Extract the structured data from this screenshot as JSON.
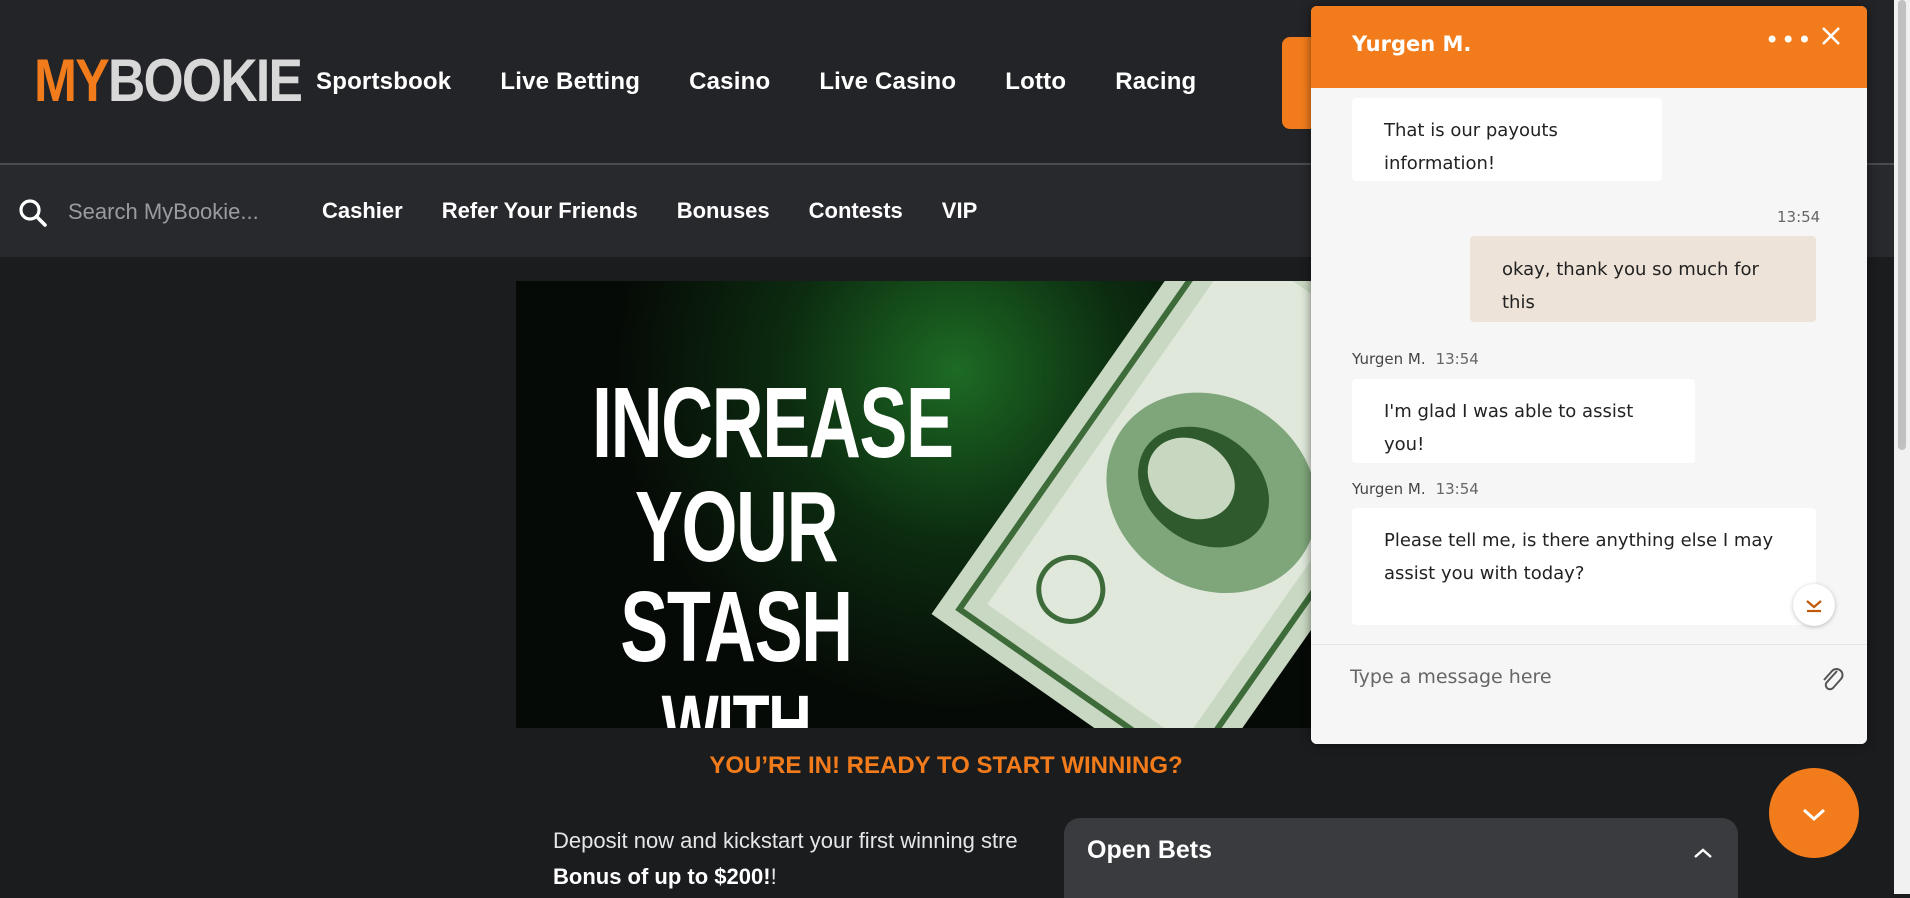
{
  "brand": {
    "my": "MY",
    "bookie": "BOOKIE"
  },
  "main_nav": [
    "Sportsbook",
    "Live Betting",
    "Casino",
    "Live Casino",
    "Lotto",
    "Racing"
  ],
  "search": {
    "placeholder": "Search MyBookie..."
  },
  "sub_nav": [
    "Cashier",
    "Refer Your Friends",
    "Bonuses",
    "Contests",
    "VIP"
  ],
  "banner": {
    "line1": "INCREASE",
    "line2": "YOUR STASH",
    "line3": "WITH CASH!",
    "headline": "YOU’RE IN! READY TO START WINNING?",
    "body_text": "Deposit now and kickstart your first winning stre",
    "body_bold": "Bonus of up to $200!",
    "body_end": "!"
  },
  "open_bets": {
    "title": "Open Bets"
  },
  "chat": {
    "agent_name": "Yurgen M.",
    "messages": [
      {
        "text": "That is our payouts information!"
      },
      {
        "time": "13:54",
        "text": "okay, thank you so much for this"
      },
      {
        "sender": "Yurgen M.",
        "time": "13:54",
        "text": "I'm glad I was able to assist you!"
      },
      {
        "sender": "Yurgen M.",
        "time": "13:54",
        "text": "Please tell me, is there anything else I may assist you with today?"
      }
    ],
    "input_placeholder": "Type a message here"
  },
  "colors": {
    "accent": "#f27c1b",
    "background": "#1b1c1e"
  }
}
